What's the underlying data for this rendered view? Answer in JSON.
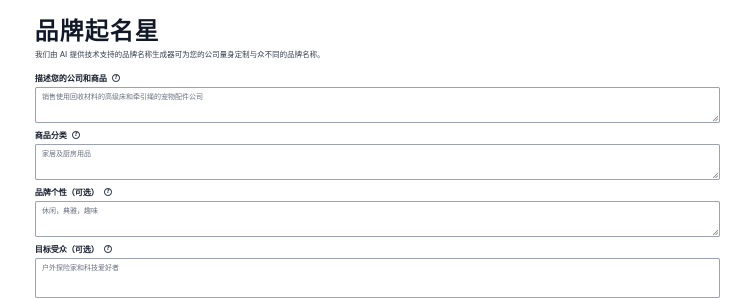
{
  "page": {
    "title": "品牌起名星",
    "subtitle": "我们由 AI 提供技术支持的品牌名称生成器可为您的公司量身定制与众不同的品牌名称。"
  },
  "fields": [
    {
      "label": "描述您的公司和商品",
      "value": "销售使用回收材料的高级床和牵引绳的宠物配件公司",
      "help_icon": "question-circle-icon"
    },
    {
      "label": "商品分类",
      "value": "家居及厨房用品",
      "help_icon": "question-circle-icon"
    },
    {
      "label": "品牌个性（可选）",
      "value": "休闲，典雅，趣味",
      "help_icon": "question-circle-icon"
    },
    {
      "label": "目标受众（可选）",
      "value": "户外探险家和科技爱好者",
      "help_icon": "question-circle-icon"
    }
  ]
}
